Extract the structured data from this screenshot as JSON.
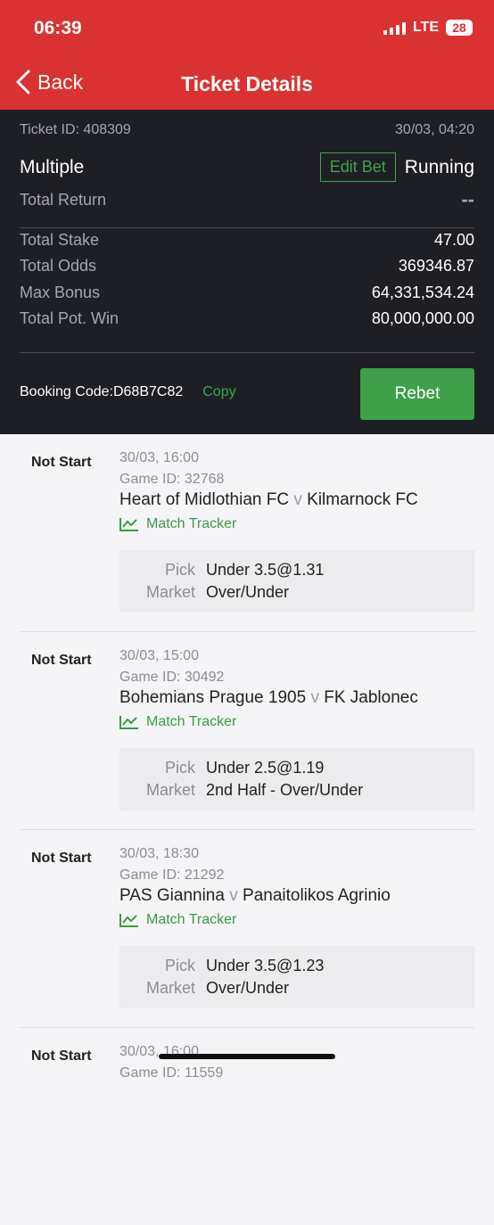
{
  "status_bar": {
    "time": "06:39",
    "network": "LTE",
    "battery": "28"
  },
  "header": {
    "back_label": "Back",
    "title": "Ticket Details"
  },
  "summary": {
    "ticket_id": "Ticket ID: 408309",
    "datetime": "30/03, 04:20",
    "bet_type": "Multiple",
    "edit_bet_label": "Edit Bet",
    "status": "Running",
    "total_return_label": "Total Return",
    "total_return_value": "--",
    "stats": [
      {
        "label": "Total Stake",
        "value": "47.00"
      },
      {
        "label": "Total Odds",
        "value": "369346.87"
      },
      {
        "label": "Max Bonus",
        "value": "64,331,534.24"
      },
      {
        "label": "Total Pot. Win",
        "value": "80,000,000.00"
      }
    ],
    "booking_code": "Booking Code:D68B7C82",
    "copy_label": "Copy",
    "rebet_label": "Rebet"
  },
  "bets": [
    {
      "status": "Not Start",
      "datetime": "30/03, 16:00",
      "game_id": "Game ID: 32768",
      "home": "Heart of Midlothian FC",
      "vs": "v",
      "away": "Kilmarnock FC",
      "tracker_label": "Match Tracker",
      "pick_label": "Pick",
      "pick": "Under 3.5@1.31",
      "market_label": "Market",
      "market": "Over/Under"
    },
    {
      "status": "Not Start",
      "datetime": "30/03, 15:00",
      "game_id": "Game ID: 30492",
      "home": "Bohemians Prague 1905",
      "vs": "v",
      "away": "FK Jablonec",
      "tracker_label": "Match Tracker",
      "pick_label": "Pick",
      "pick": "Under 2.5@1.19",
      "market_label": "Market",
      "market": "2nd Half - Over/Under"
    },
    {
      "status": "Not Start",
      "datetime": "30/03, 18:30",
      "game_id": "Game ID: 21292",
      "home": "PAS Giannina",
      "vs": "v",
      "away": "Panaitolikos Agrinio",
      "tracker_label": "Match Tracker",
      "pick_label": "Pick",
      "pick": "Under 3.5@1.23",
      "market_label": "Market",
      "market": "Over/Under"
    },
    {
      "status": "Not Start",
      "datetime": "30/03, 16:00",
      "game_id": "Game ID: 11559"
    }
  ],
  "colors": {
    "header": "#da3232",
    "panel": "#1e1f25",
    "accent_green": "#3fa04a"
  }
}
